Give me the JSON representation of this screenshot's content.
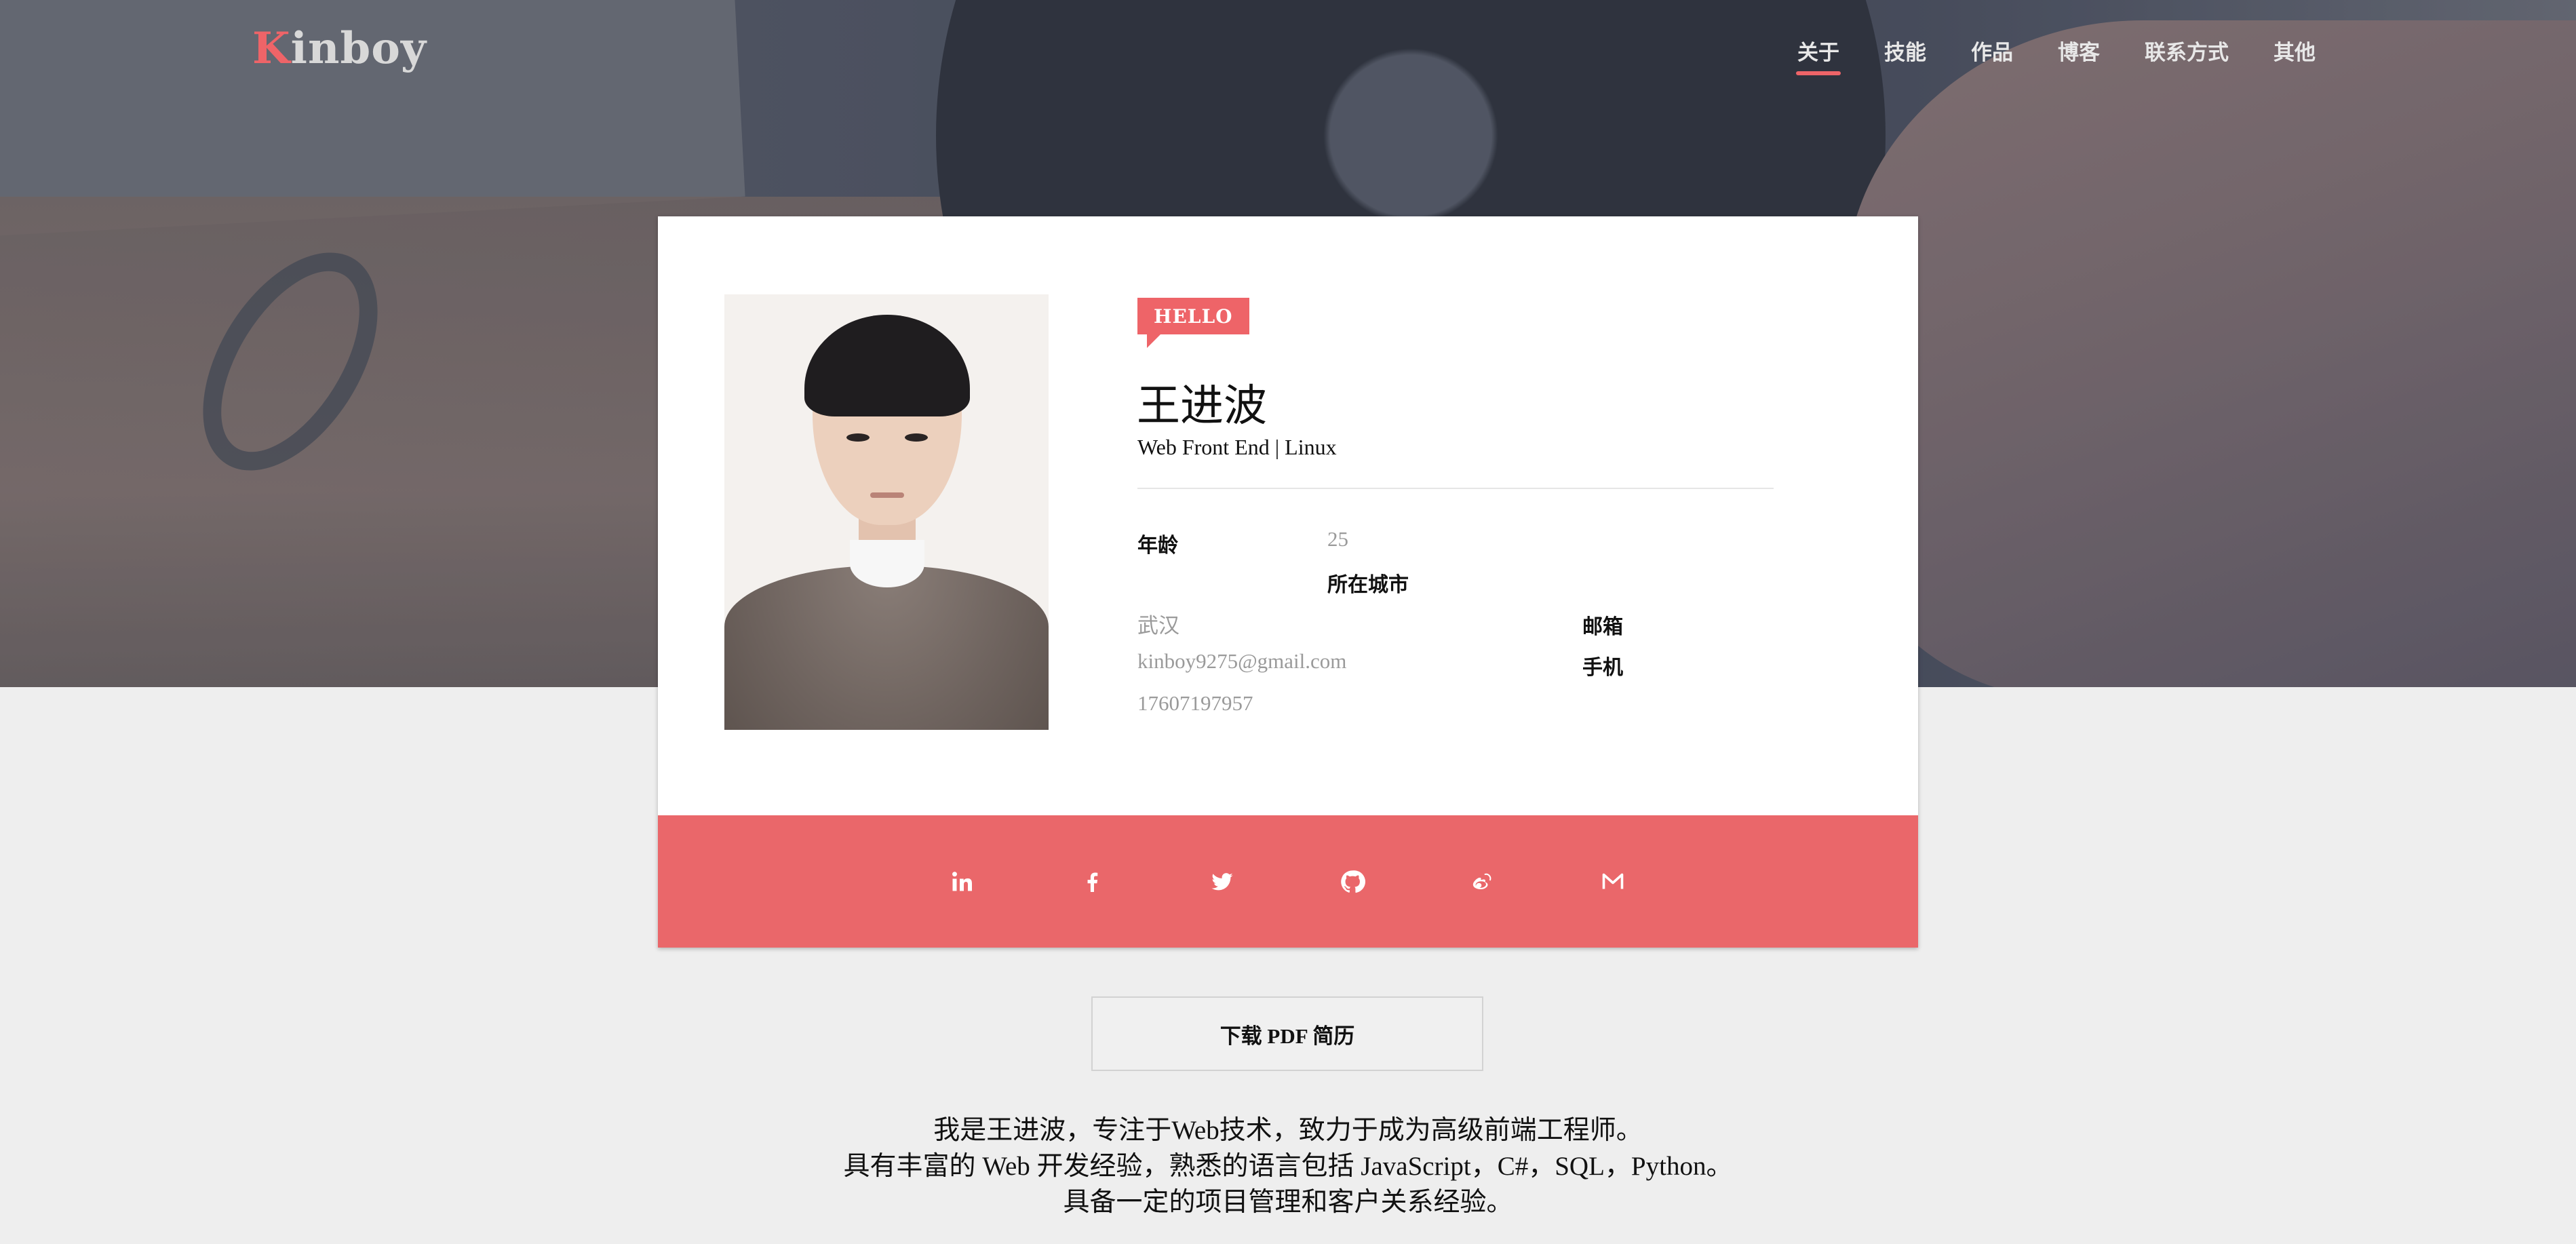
{
  "brand": {
    "initial": "K",
    "rest": "inboy"
  },
  "nav": {
    "items": [
      "关于",
      "技能",
      "作品",
      "博客",
      "联系方式",
      "其他"
    ],
    "active_index": 0
  },
  "profile": {
    "badge": "HELLO",
    "name": "王进波",
    "subtitle": "Web Front End | Linux",
    "fields": {
      "age_label": "年龄",
      "age_value": "25",
      "city_label": "所在城市",
      "city_value": "武汉",
      "email_label": "邮箱",
      "email_value": "kinboy9275@gmail.com",
      "phone_label": "手机",
      "phone_value": "17607197957"
    }
  },
  "social": {
    "icons": [
      "linkedin-icon",
      "facebook-icon",
      "twitter-icon",
      "github-icon",
      "weibo-icon",
      "gmail-icon"
    ]
  },
  "download": {
    "label": "下载 PDF 简历"
  },
  "intro": {
    "lines": [
      "我是王进波，专注于Web技术，致力于成为高级前端工程师。",
      "具有丰富的 Web 开发经验，熟悉的语言包括 JavaScript，C#，SQL，Python。",
      "具备一定的项目管理和客户关系经验。"
    ]
  },
  "colors": {
    "accent": "#ee6468",
    "social_bar": "#ea676a",
    "page_bg": "#eeeeee",
    "muted_text": "#9a9a9a"
  }
}
